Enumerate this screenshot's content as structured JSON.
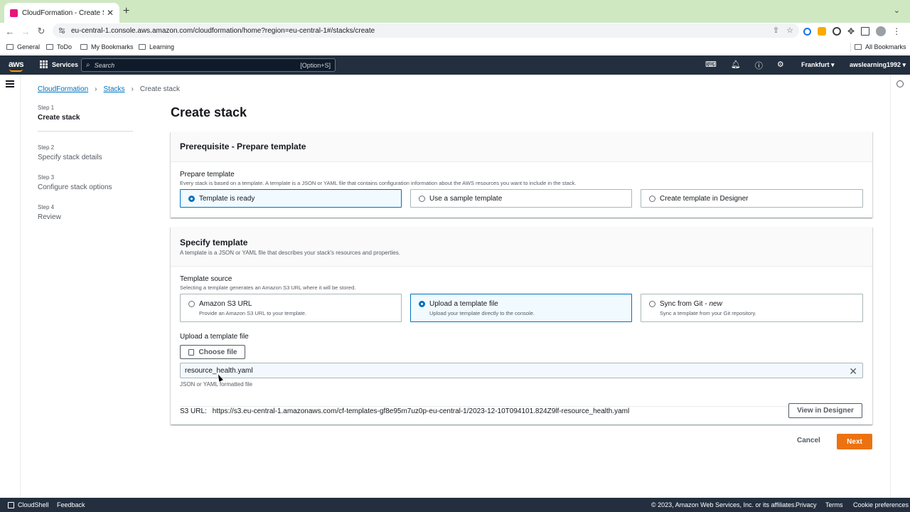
{
  "browser": {
    "tab_title": "CloudFormation - Create Stac",
    "url": "eu-central-1.console.aws.amazon.com/cloudformation/home?region=eu-central-1#/stacks/create",
    "bookmarks": [
      "General",
      "ToDo",
      "My Bookmarks",
      "Learning"
    ],
    "all_bookmarks": "All Bookmarks"
  },
  "aws_nav": {
    "logo": "aws",
    "services": "Services",
    "search_placeholder": "Search",
    "search_shortcut": "[Option+S]",
    "region": "Frankfurt",
    "account": "awslearning1992"
  },
  "breadcrumb": [
    "CloudFormation",
    "Stacks",
    "Create stack"
  ],
  "steps": [
    {
      "num": "Step 1",
      "label": "Create stack"
    },
    {
      "num": "Step 2",
      "label": "Specify stack details"
    },
    {
      "num": "Step 3",
      "label": "Configure stack options"
    },
    {
      "num": "Step 4",
      "label": "Review"
    }
  ],
  "page_title": "Create stack",
  "prereq": {
    "title": "Prerequisite - Prepare template",
    "field_label": "Prepare template",
    "field_desc": "Every stack is based on a template. A template is a JSON or YAML file that contains configuration information about the AWS resources you want to include in the stack.",
    "options": [
      "Template is ready",
      "Use a sample template",
      "Create template in Designer"
    ],
    "selected": "Template is ready"
  },
  "specify": {
    "title": "Specify template",
    "desc": "A template is a JSON or YAML file that describes your stack's resources and properties.",
    "source_label": "Template source",
    "source_desc": "Selecting a template generates an Amazon S3 URL where it will be stored.",
    "options": [
      {
        "title": "Amazon S3 URL",
        "desc": "Provide an Amazon S3 URL to your template."
      },
      {
        "title": "Upload a template file",
        "desc": "Upload your template directly to the console."
      },
      {
        "title": "Sync from Git - ",
        "title_suffix": "new",
        "desc": "Sync a template from your Git repository."
      }
    ],
    "selected": "Upload a template file",
    "upload_label": "Upload a template file",
    "choose_file": "Choose file",
    "file_name": "resource_health.yaml",
    "file_hint": "JSON or YAML formatted file",
    "s3_label": "S3 URL:",
    "s3_url": "https://s3.eu-central-1.amazonaws.com/cf-templates-gf8e95m7uz0p-eu-central-1/2023-12-10T094101.824Z9lf-resource_health.yaml",
    "view_designer": "View in Designer"
  },
  "actions": {
    "cancel": "Cancel",
    "next": "Next"
  },
  "footer": {
    "cloudshell": "CloudShell",
    "feedback": "Feedback",
    "copyright": "© 2023, Amazon Web Services, Inc. or its affiliates.",
    "privacy": "Privacy",
    "terms": "Terms",
    "cookie": "Cookie preferences"
  },
  "colors": {
    "accent": "#0073bb",
    "primary_button": "#ec7211",
    "nav_bg": "#232f3e"
  }
}
